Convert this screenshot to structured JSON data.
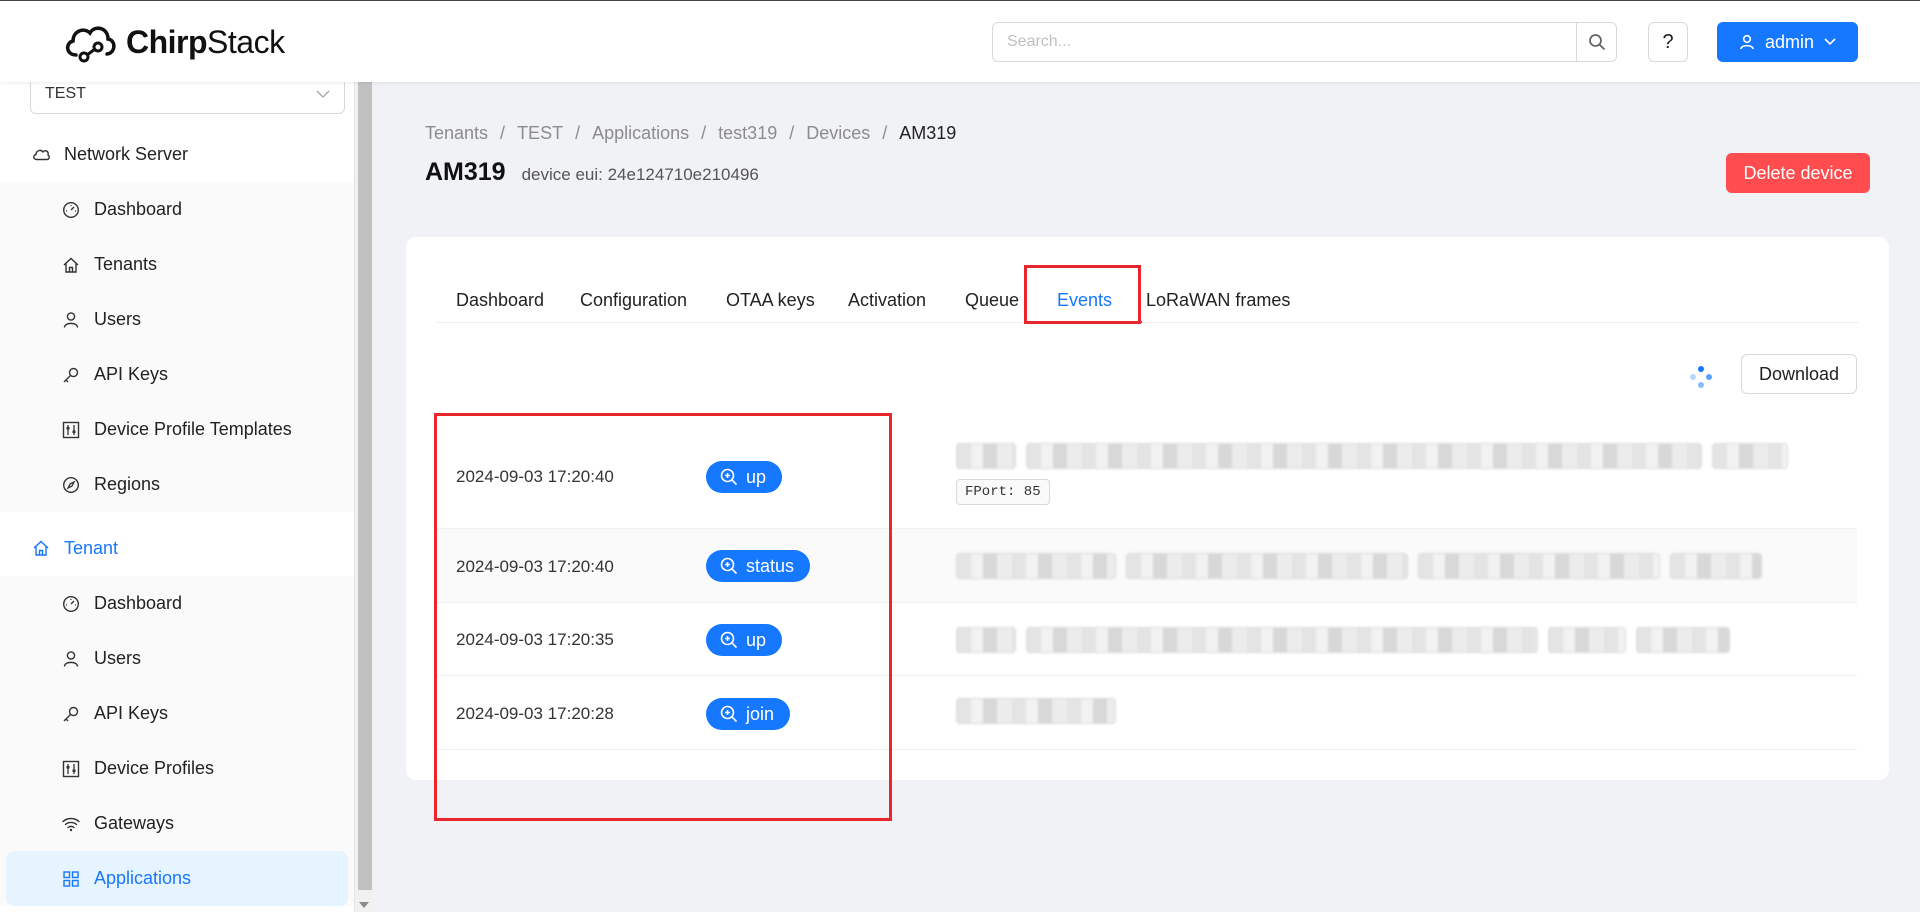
{
  "app": {
    "logo_text_bold": "Chirp",
    "logo_text": "Stack"
  },
  "header": {
    "search_placeholder": "Search...",
    "help_label": "?",
    "user_label": "admin"
  },
  "sidebar": {
    "tenant_select": "TEST",
    "network_server": {
      "label": "Network Server",
      "items": [
        {
          "label": "Dashboard",
          "icon": "dashboard-icon"
        },
        {
          "label": "Tenants",
          "icon": "home-icon"
        },
        {
          "label": "Users",
          "icon": "user-icon"
        },
        {
          "label": "API Keys",
          "icon": "key-icon"
        },
        {
          "label": "Device Profile Templates",
          "icon": "sliders-icon"
        },
        {
          "label": "Regions",
          "icon": "compass-icon"
        }
      ]
    },
    "tenant": {
      "label": "Tenant",
      "items": [
        {
          "label": "Dashboard",
          "icon": "dashboard-icon"
        },
        {
          "label": "Users",
          "icon": "user-icon"
        },
        {
          "label": "API Keys",
          "icon": "key-icon"
        },
        {
          "label": "Device Profiles",
          "icon": "sliders-icon"
        },
        {
          "label": "Gateways",
          "icon": "wifi-icon"
        },
        {
          "label": "Applications",
          "icon": "apps-icon"
        }
      ]
    }
  },
  "breadcrumb": [
    "Tenants",
    "TEST",
    "Applications",
    "test319",
    "Devices",
    "AM319"
  ],
  "page": {
    "title": "AM319",
    "subtitle": "device eui: 24e124710e210496",
    "delete_label": "Delete device"
  },
  "tabs": [
    "Dashboard",
    "Configuration",
    "OTAA keys",
    "Activation",
    "Queue",
    "Events",
    "LoRaWAN frames"
  ],
  "active_tab": "Events",
  "download_label": "Download",
  "events": [
    {
      "time": "2024-09-03 17:20:40",
      "type": "up",
      "fport": "FPort: 85"
    },
    {
      "time": "2024-09-03 17:20:40",
      "type": "status"
    },
    {
      "time": "2024-09-03 17:20:35",
      "type": "up"
    },
    {
      "time": "2024-09-03 17:20:28",
      "type": "join"
    }
  ],
  "colors": {
    "primary": "#1677ff",
    "danger": "#ff4d4f",
    "highlight": "#e8262b"
  }
}
